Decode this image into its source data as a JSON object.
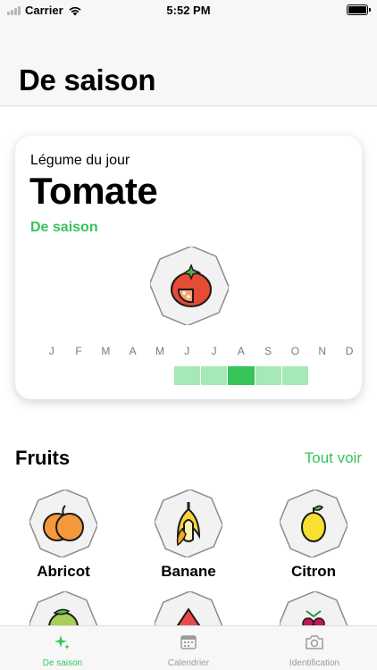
{
  "status_bar": {
    "carrier": "Carrier",
    "time": "5:52 PM",
    "battery_level": 1.0
  },
  "header": {
    "title": "De saison"
  },
  "featured": {
    "subtitle": "Légume du jour",
    "name": "Tomate",
    "status": "De saison",
    "icon": "tomato-icon",
    "months": [
      "J",
      "F",
      "M",
      "A",
      "M",
      "J",
      "J",
      "A",
      "S",
      "O",
      "N",
      "D"
    ],
    "season_months": [
      6,
      7,
      8,
      9,
      10
    ],
    "peak_month": 8,
    "season_color": "#a6e8b8",
    "peak_color": "#37c45a"
  },
  "fruits": {
    "title": "Fruits",
    "see_all": "Tout voir",
    "items": [
      {
        "name": "Abricot",
        "icon": "apricot-icon"
      },
      {
        "name": "Banane",
        "icon": "banana-icon"
      },
      {
        "name": "Citron",
        "icon": "lemon-icon"
      },
      {
        "name": "",
        "icon": "lime-icon"
      },
      {
        "name": "",
        "icon": "watermelon-icon"
      },
      {
        "name": "",
        "icon": "berries-icon"
      }
    ]
  },
  "tabbar": {
    "tabs": [
      {
        "label": "De saison",
        "icon": "sparkle-icon",
        "active": true
      },
      {
        "label": "Calendrier",
        "icon": "calendar-icon",
        "active": false
      },
      {
        "label": "Identification",
        "icon": "camera-icon",
        "active": false
      }
    ]
  },
  "colors": {
    "accent": "#37c45a"
  }
}
